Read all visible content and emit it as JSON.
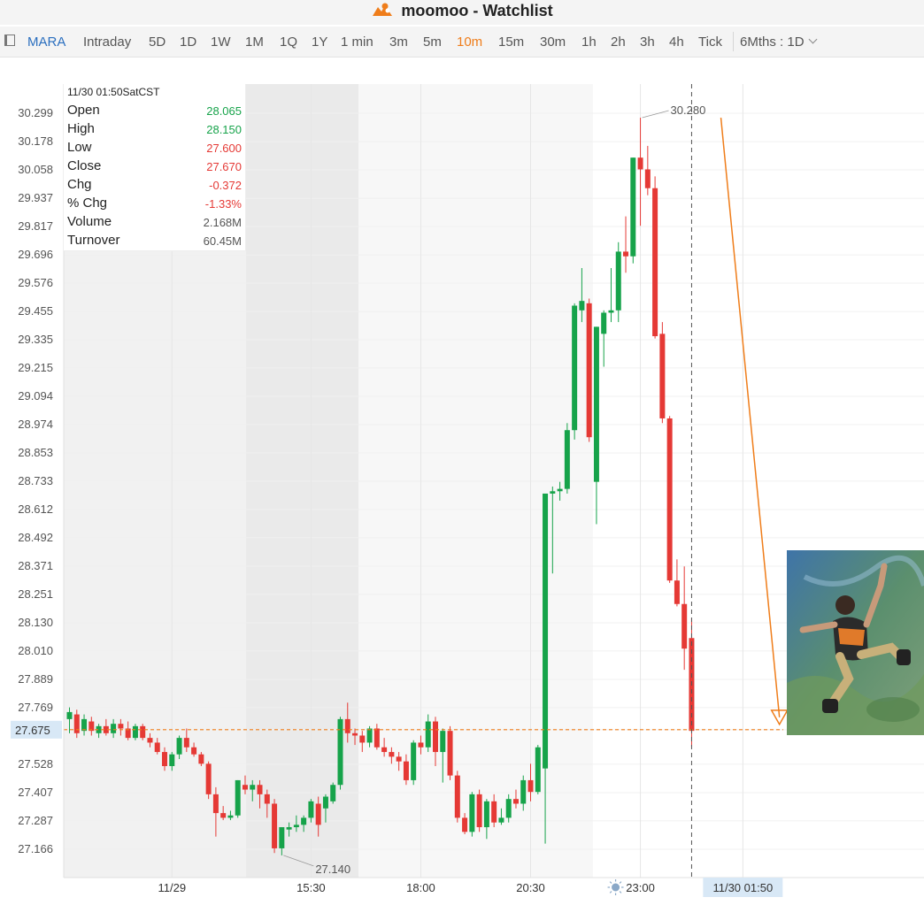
{
  "window": {
    "title": "moomoo - Watchlist",
    "logo_icon": "moomoo-logo-icon"
  },
  "toolbar": {
    "symbol": "MARA",
    "intervals": [
      "Intraday",
      "5D",
      "1D",
      "1W",
      "1M",
      "1Q",
      "1Y",
      "1 min",
      "3m",
      "5m",
      "10m",
      "15m",
      "30m",
      "1h",
      "2h",
      "3h",
      "4h",
      "Tick"
    ],
    "active_interval": "10m",
    "range_selector": "6Mths : 1D"
  },
  "info_panel": {
    "datetime": "11/30 01:50SatCST",
    "rows": [
      {
        "label": "Open",
        "value": "28.065",
        "color": "#16a34a"
      },
      {
        "label": "High",
        "value": "28.150",
        "color": "#16a34a"
      },
      {
        "label": "Low",
        "value": "27.600",
        "color": "#e53935"
      },
      {
        "label": "Close",
        "value": "27.670",
        "color": "#e53935"
      },
      {
        "label": "Chg",
        "value": "-0.372",
        "color": "#e53935"
      },
      {
        "label": "% Chg",
        "value": "-1.33%",
        "color": "#e53935"
      },
      {
        "label": "Volume",
        "value": "2.168M",
        "color": "#555555"
      },
      {
        "label": "Turnover",
        "value": "60.45M",
        "color": "#555555"
      }
    ]
  },
  "chart_data": {
    "type": "candlestick",
    "symbol": "MARA",
    "interval": "10m",
    "y_ticks": [
      30.299,
      30.178,
      30.058,
      29.937,
      29.817,
      29.696,
      29.576,
      29.455,
      29.335,
      29.215,
      29.094,
      28.974,
      28.853,
      28.733,
      28.612,
      28.492,
      28.371,
      28.251,
      28.13,
      28.01,
      27.889,
      27.769,
      27.675,
      27.528,
      27.407,
      27.287,
      27.166
    ],
    "y_tick_labels": [
      "30.299",
      "30.178",
      "30.058",
      "29.937",
      "29.817",
      "29.696",
      "29.576",
      "29.455",
      "29.335",
      "29.215",
      "29.094",
      "28.974",
      "28.853",
      "28.733",
      "28.612",
      "28.492",
      "28.371",
      "28.251",
      "28.130",
      "28.010",
      "27.889",
      "27.769",
      "27.675",
      "27.528",
      "27.407",
      "27.287",
      "27.166"
    ],
    "current_price": 27.675,
    "current_price_label": "27.675",
    "x_labels": [
      {
        "label": "11/29",
        "bar": 14
      },
      {
        "label": "15:30",
        "bar": 33
      },
      {
        "label": "18:00",
        "bar": 48
      },
      {
        "label": "20:30",
        "bar": 63
      },
      {
        "label": "23:00",
        "bar": 78
      },
      {
        "label": "11/30 01:50",
        "bar": 92
      }
    ],
    "annotations": [
      {
        "label": "30.280",
        "price": 30.28
      },
      {
        "label": "27.140",
        "price": 27.14
      }
    ],
    "drawing": {
      "type": "arrow",
      "from": {
        "bar": 89,
        "price": 30.28
      },
      "to": {
        "bar": 97,
        "price": 27.69
      },
      "color": "#ef7d1a"
    },
    "colors": {
      "up": "#16a34a",
      "down": "#e53935",
      "line": "#ef7d1a"
    },
    "candles": [
      {
        "o": 27.72,
        "h": 27.77,
        "l": 27.66,
        "c": 27.75
      },
      {
        "o": 27.74,
        "h": 27.76,
        "l": 27.64,
        "c": 27.66
      },
      {
        "o": 27.67,
        "h": 27.74,
        "l": 27.65,
        "c": 27.72
      },
      {
        "o": 27.71,
        "h": 27.73,
        "l": 27.65,
        "c": 27.67
      },
      {
        "o": 27.66,
        "h": 27.7,
        "l": 27.64,
        "c": 27.69
      },
      {
        "o": 27.69,
        "h": 27.72,
        "l": 27.65,
        "c": 27.66
      },
      {
        "o": 27.66,
        "h": 27.72,
        "l": 27.64,
        "c": 27.7
      },
      {
        "o": 27.7,
        "h": 27.72,
        "l": 27.65,
        "c": 27.68
      },
      {
        "o": 27.68,
        "h": 27.71,
        "l": 27.63,
        "c": 27.64
      },
      {
        "o": 27.64,
        "h": 27.7,
        "l": 27.63,
        "c": 27.69
      },
      {
        "o": 27.69,
        "h": 27.7,
        "l": 27.63,
        "c": 27.64
      },
      {
        "o": 27.64,
        "h": 27.66,
        "l": 27.6,
        "c": 27.62
      },
      {
        "o": 27.62,
        "h": 27.64,
        "l": 27.57,
        "c": 27.58
      },
      {
        "o": 27.58,
        "h": 27.6,
        "l": 27.5,
        "c": 27.52
      },
      {
        "o": 27.52,
        "h": 27.58,
        "l": 27.5,
        "c": 27.57
      },
      {
        "o": 27.57,
        "h": 27.65,
        "l": 27.55,
        "c": 27.64
      },
      {
        "o": 27.64,
        "h": 27.68,
        "l": 27.58,
        "c": 27.6
      },
      {
        "o": 27.6,
        "h": 27.62,
        "l": 27.56,
        "c": 27.57
      },
      {
        "o": 27.57,
        "h": 27.58,
        "l": 27.52,
        "c": 27.53
      },
      {
        "o": 27.53,
        "h": 27.54,
        "l": 27.38,
        "c": 27.4
      },
      {
        "o": 27.4,
        "h": 27.43,
        "l": 27.22,
        "c": 27.32
      },
      {
        "o": 27.32,
        "h": 27.35,
        "l": 27.29,
        "c": 27.3
      },
      {
        "o": 27.3,
        "h": 27.33,
        "l": 27.29,
        "c": 27.31
      },
      {
        "o": 27.31,
        "h": 27.46,
        "l": 27.3,
        "c": 27.46
      },
      {
        "o": 27.44,
        "h": 27.48,
        "l": 27.4,
        "c": 27.42
      },
      {
        "o": 27.42,
        "h": 27.46,
        "l": 27.37,
        "c": 27.44
      },
      {
        "o": 27.44,
        "h": 27.46,
        "l": 27.34,
        "c": 27.4
      },
      {
        "o": 27.4,
        "h": 27.42,
        "l": 27.3,
        "c": 27.36
      },
      {
        "o": 27.36,
        "h": 27.38,
        "l": 27.15,
        "c": 27.17
      },
      {
        "o": 27.17,
        "h": 27.26,
        "l": 27.14,
        "c": 27.26
      },
      {
        "o": 27.25,
        "h": 27.28,
        "l": 27.22,
        "c": 27.26
      },
      {
        "o": 27.26,
        "h": 27.31,
        "l": 27.24,
        "c": 27.27
      },
      {
        "o": 27.27,
        "h": 27.31,
        "l": 27.24,
        "c": 27.3
      },
      {
        "o": 27.3,
        "h": 27.38,
        "l": 27.28,
        "c": 27.37
      },
      {
        "o": 27.36,
        "h": 27.39,
        "l": 27.22,
        "c": 27.27
      },
      {
        "o": 27.34,
        "h": 27.4,
        "l": 27.28,
        "c": 27.39
      },
      {
        "o": 27.37,
        "h": 27.45,
        "l": 27.36,
        "c": 27.44
      },
      {
        "o": 27.44,
        "h": 27.73,
        "l": 27.42,
        "c": 27.72
      },
      {
        "o": 27.72,
        "h": 27.79,
        "l": 27.62,
        "c": 27.66
      },
      {
        "o": 27.66,
        "h": 27.68,
        "l": 27.61,
        "c": 27.65
      },
      {
        "o": 27.65,
        "h": 27.67,
        "l": 27.58,
        "c": 27.62
      },
      {
        "o": 27.62,
        "h": 27.69,
        "l": 27.6,
        "c": 27.68
      },
      {
        "o": 27.68,
        "h": 27.7,
        "l": 27.59,
        "c": 27.6
      },
      {
        "o": 27.6,
        "h": 27.64,
        "l": 27.56,
        "c": 27.58
      },
      {
        "o": 27.58,
        "h": 27.6,
        "l": 27.53,
        "c": 27.56
      },
      {
        "o": 27.56,
        "h": 27.58,
        "l": 27.5,
        "c": 27.54
      },
      {
        "o": 27.54,
        "h": 27.57,
        "l": 27.44,
        "c": 27.46
      },
      {
        "o": 27.46,
        "h": 27.63,
        "l": 27.44,
        "c": 27.62
      },
      {
        "o": 27.62,
        "h": 27.65,
        "l": 27.57,
        "c": 27.6
      },
      {
        "o": 27.6,
        "h": 27.74,
        "l": 27.58,
        "c": 27.71
      },
      {
        "o": 27.71,
        "h": 27.73,
        "l": 27.52,
        "c": 27.58
      },
      {
        "o": 27.58,
        "h": 27.68,
        "l": 27.45,
        "c": 27.67
      },
      {
        "o": 27.67,
        "h": 27.69,
        "l": 27.46,
        "c": 27.48
      },
      {
        "o": 27.48,
        "h": 27.5,
        "l": 27.28,
        "c": 27.3
      },
      {
        "o": 27.3,
        "h": 27.32,
        "l": 27.23,
        "c": 27.24
      },
      {
        "o": 27.24,
        "h": 27.41,
        "l": 27.22,
        "c": 27.4
      },
      {
        "o": 27.4,
        "h": 27.42,
        "l": 27.24,
        "c": 27.26
      },
      {
        "o": 27.26,
        "h": 27.38,
        "l": 27.21,
        "c": 27.37
      },
      {
        "o": 27.37,
        "h": 27.4,
        "l": 27.26,
        "c": 27.28
      },
      {
        "o": 27.28,
        "h": 27.34,
        "l": 27.27,
        "c": 27.3
      },
      {
        "o": 27.3,
        "h": 27.4,
        "l": 27.28,
        "c": 27.38
      },
      {
        "o": 27.38,
        "h": 27.42,
        "l": 27.34,
        "c": 27.36
      },
      {
        "o": 27.36,
        "h": 27.48,
        "l": 27.33,
        "c": 27.46
      },
      {
        "o": 27.46,
        "h": 27.53,
        "l": 27.37,
        "c": 27.41
      },
      {
        "o": 27.41,
        "h": 27.61,
        "l": 27.4,
        "c": 27.6
      },
      {
        "o": 27.51,
        "h": 28.68,
        "l": 27.19,
        "c": 28.68
      },
      {
        "o": 28.68,
        "h": 28.71,
        "l": 28.34,
        "c": 28.69
      },
      {
        "o": 28.69,
        "h": 28.73,
        "l": 28.65,
        "c": 28.7
      },
      {
        "o": 28.7,
        "h": 28.98,
        "l": 28.68,
        "c": 28.95
      },
      {
        "o": 28.95,
        "h": 29.49,
        "l": 28.91,
        "c": 29.48
      },
      {
        "o": 29.46,
        "h": 29.64,
        "l": 29.41,
        "c": 29.5
      },
      {
        "o": 29.49,
        "h": 29.51,
        "l": 28.9,
        "c": 28.92
      },
      {
        "o": 28.73,
        "h": 29.39,
        "l": 28.55,
        "c": 29.39
      },
      {
        "o": 29.36,
        "h": 29.46,
        "l": 29.22,
        "c": 29.45
      },
      {
        "o": 29.45,
        "h": 29.64,
        "l": 29.41,
        "c": 29.46
      },
      {
        "o": 29.46,
        "h": 29.75,
        "l": 29.41,
        "c": 29.71
      },
      {
        "o": 29.71,
        "h": 29.86,
        "l": 29.62,
        "c": 29.69
      },
      {
        "o": 29.69,
        "h": 30.11,
        "l": 29.66,
        "c": 30.11
      },
      {
        "o": 30.11,
        "h": 30.28,
        "l": 29.82,
        "c": 30.06
      },
      {
        "o": 30.06,
        "h": 30.16,
        "l": 29.95,
        "c": 29.98
      },
      {
        "o": 29.98,
        "h": 30.03,
        "l": 29.34,
        "c": 29.35
      },
      {
        "o": 29.36,
        "h": 29.41,
        "l": 28.98,
        "c": 29.0
      },
      {
        "o": 29.0,
        "h": 29.01,
        "l": 28.3,
        "c": 28.31
      },
      {
        "o": 28.31,
        "h": 28.4,
        "l": 28.2,
        "c": 28.21
      },
      {
        "o": 28.21,
        "h": 28.37,
        "l": 27.93,
        "c": 28.02
      },
      {
        "o": 28.065,
        "h": 28.15,
        "l": 27.6,
        "c": 27.67
      }
    ]
  },
  "photo": {
    "name": "skydiver-photo"
  }
}
